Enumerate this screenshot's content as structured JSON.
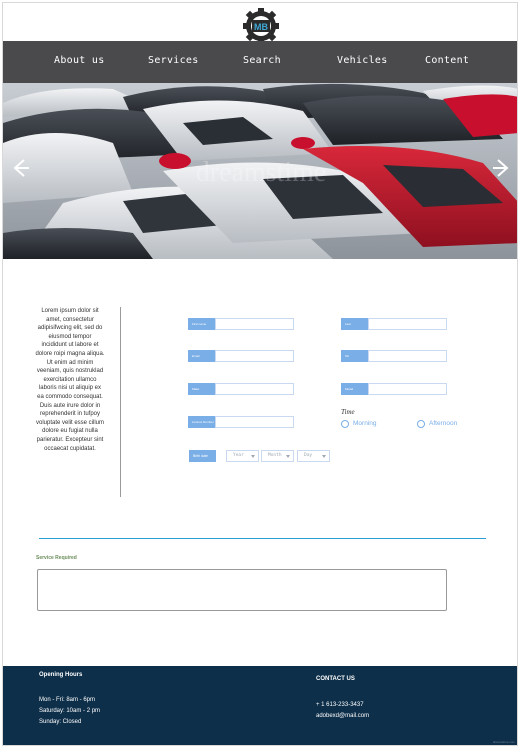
{
  "brand": {
    "logo_text": "MB"
  },
  "nav": {
    "items": [
      {
        "label": "About us"
      },
      {
        "label": "Services"
      },
      {
        "label": "Search"
      },
      {
        "label": "Vehicles"
      },
      {
        "label": "Content"
      }
    ]
  },
  "hero": {
    "watermark": "dreamstime"
  },
  "intro": {
    "text": "Lorem ipsum dolor sit amet, consectetur adipisifwcing elit, sed do eiusmod tempor incididunt ut labore et dolore roipi magna aliqua. Ut enim ad minim veeniam, quis nostruklad exercitation ullamco laboris nisi ut aliquip ex ea commodo consequat. Duis aute irure dolor in reprehenderit in tufpoy voluptate velit esse cillum dolore eu fugiat nulla parieratur. Excepteur sint occaecat cupidatat."
  },
  "form": {
    "left_fields": [
      {
        "label": "First name",
        "value": ""
      },
      {
        "label": "Email",
        "value": ""
      },
      {
        "label": "Make",
        "value": ""
      },
      {
        "label": "Licence Number",
        "value": ""
      }
    ],
    "right_fields": [
      {
        "label": "Last",
        "value": ""
      },
      {
        "label": "Tel",
        "value": ""
      },
      {
        "label": "Model",
        "value": ""
      }
    ],
    "time": {
      "label": "Time",
      "options": [
        "Morning",
        "Afternoon"
      ]
    },
    "dob": {
      "label": "Birth date",
      "selects": [
        "Year",
        "Month",
        "Day"
      ]
    },
    "service": {
      "label": "Service Required",
      "value": ""
    }
  },
  "footer": {
    "hours_title": "Opening Hours",
    "hours": [
      "Mon - Fri: 8am - 6pm",
      "Saturday: 10am - 2 pm",
      "Sunday: Closed"
    ],
    "contact_title": "CONTACT US",
    "phone": "+ 1 613-233-3437",
    "email": "adobexd@mail.com",
    "watermark": "dreamstime.com"
  },
  "colors": {
    "nav_bg": "#4a4a4d",
    "accent": "#7aaee6",
    "divider": "#2a9fd6",
    "footer_bg": "#0e2f4a"
  }
}
